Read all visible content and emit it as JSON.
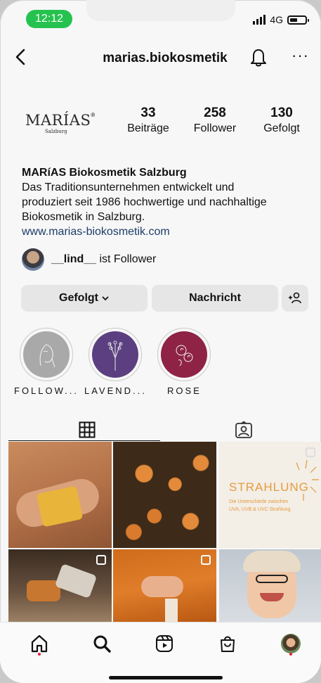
{
  "status": {
    "time": "12:12",
    "network": "4G"
  },
  "header": {
    "username": "marias.biokosmetik"
  },
  "logo": {
    "main": "MARÍAS",
    "reg": "®",
    "sub": "Salzburg"
  },
  "stats": [
    {
      "value": "33",
      "label": "Beiträge"
    },
    {
      "value": "258",
      "label": "Follower"
    },
    {
      "value": "130",
      "label": "Gefolgt"
    }
  ],
  "bio": {
    "name": "MARíAS Biokosmetik Salzburg",
    "lines": [
      "Das Traditionsunternehmen entwickelt und",
      "produziert seit 1986 hochwertige und nachhaltige",
      "Biokosmetik in Salzburg."
    ],
    "link": "www.marias-biokosmetik.com"
  },
  "followed_by": {
    "user": "__lind__",
    "suffix": " ist Follower"
  },
  "buttons": {
    "following": "Gefolgt",
    "message": "Nachricht"
  },
  "highlights": [
    {
      "label": "FOLLOW...",
      "color": "#a9a9a9"
    },
    {
      "label": "LAVEND...",
      "color": "#5b3f80"
    },
    {
      "label": "ROSE",
      "color": "#8e2346"
    }
  ],
  "post_text": {
    "title": "STRAHLUNG",
    "line1": "Die Unterschiede zwischen",
    "line2": "UVA, UVB & UVC Strahlung."
  },
  "colors": {
    "accent_orange": "#e59b3c",
    "notification_dot": "#e0223a",
    "status_green": "#26c24f"
  }
}
